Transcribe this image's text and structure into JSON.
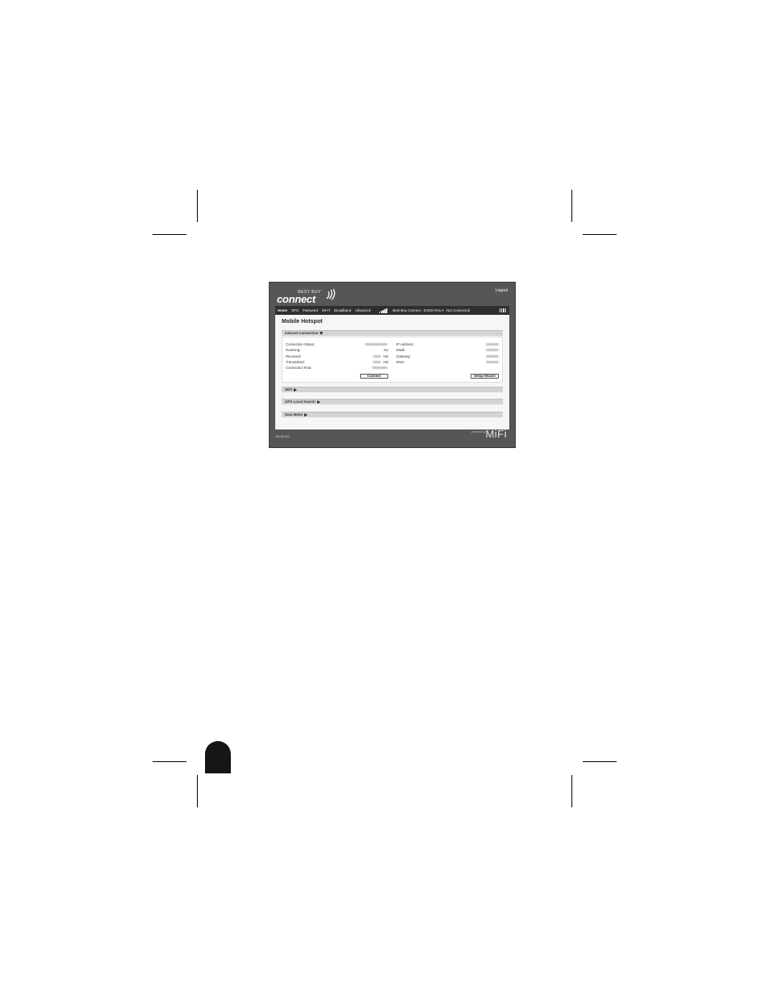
{
  "brand": {
    "small_text": "BEST BUY",
    "big_text": "connect"
  },
  "header": {
    "logout_label": "Logout"
  },
  "nav": {
    "items": [
      {
        "label": "Home"
      },
      {
        "label": "GPS"
      },
      {
        "label": "Password"
      },
      {
        "label": "Wi-Fi"
      },
      {
        "label": "Broadband"
      },
      {
        "label": "Advanced"
      }
    ],
    "network_name": "Best Buy Connect",
    "network_type": "EVDO Rev.A",
    "connection_state": "Not Connected"
  },
  "main": {
    "title": "Mobile Hotspot",
    "internet_section_label": "Internet Connection",
    "left_fields": [
      {
        "label": "Connection Status:",
        "value": ""
      },
      {
        "label": "Roaming:",
        "value": "No"
      },
      {
        "label": "Received:",
        "value": "KB"
      },
      {
        "label": "Transmitted:",
        "value": "KB"
      },
      {
        "label": "Connected Time:",
        "value": ""
      }
    ],
    "right_fields": [
      {
        "label": "IP Address:"
      },
      {
        "label": "Mask:"
      },
      {
        "label": "Gateway:"
      },
      {
        "label": "DNS:"
      }
    ],
    "connect_button": "Connect",
    "setup_wizard_button": "Setup Wizard",
    "collapsed_sections": [
      {
        "label": "WiFi"
      },
      {
        "label": "GPS Local Search"
      },
      {
        "label": "Data Meter"
      }
    ]
  },
  "footer": {
    "model": "SB-MHS2",
    "powered_by": "powered by",
    "mifi_logo": "MiFi"
  },
  "colors": {
    "frame": "#565656",
    "navbar": "#2f2f2f",
    "content": "#f6f6f6",
    "section_bar": "#d4d4d4"
  }
}
